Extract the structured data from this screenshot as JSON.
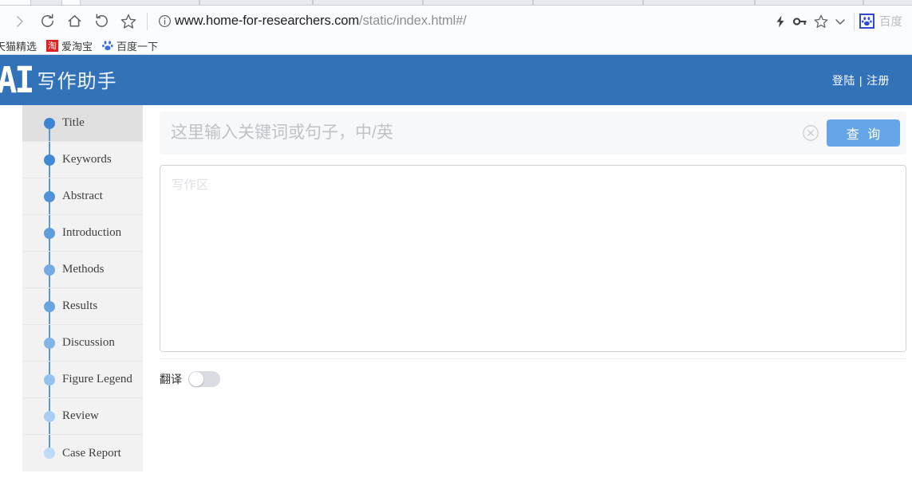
{
  "browser": {
    "toolbar_icons": [
      "forward-arrow-icon",
      "reload-icon",
      "home-icon",
      "back-history-icon",
      "bookmark-star-icon"
    ],
    "url_domain": "www.home-for-researchers.com",
    "url_path": "/static/index.html#/",
    "right_icons": [
      "lightning-icon",
      "key-icon",
      "star-icon",
      "chevron-down-icon"
    ],
    "extension_name": "百度",
    "extension_icon": "baidu-paw-icon",
    "bookmarks": [
      {
        "label": "天猫精选",
        "icon": ""
      },
      {
        "label": "爱淘宝",
        "icon": "taobao-icon"
      },
      {
        "label": "百度一下",
        "icon": "baidu-paw-icon"
      }
    ]
  },
  "header": {
    "logo_ai": "AI",
    "logo_cn": "写作助手",
    "login": "登陆",
    "divider": "|",
    "register": "注册"
  },
  "sidebar": {
    "items": [
      {
        "label": "Title",
        "active": true
      },
      {
        "label": "Keywords",
        "active": false
      },
      {
        "label": "Abstract",
        "active": false
      },
      {
        "label": "Introduction",
        "active": false
      },
      {
        "label": "Methods",
        "active": false
      },
      {
        "label": "Results",
        "active": false
      },
      {
        "label": "Discussion",
        "active": false
      },
      {
        "label": "Figure Legend",
        "active": false
      },
      {
        "label": "Review",
        "active": false
      },
      {
        "label": "Case Report",
        "active": false
      }
    ]
  },
  "search": {
    "value": "",
    "placeholder": "这里输入关键词或句子，中/英",
    "clear_icon": "clear-circle-icon",
    "button_label": "查 询"
  },
  "editor": {
    "value": "",
    "placeholder": "写作区"
  },
  "translate": {
    "label": "翻译",
    "enabled": false
  },
  "colors": {
    "header_blue": "#3272b8",
    "button_blue": "#65a5e8",
    "timeline_blue": "#3f84d2",
    "sidebar_bg": "#f2f2f2",
    "sidebar_active_bg": "#e0e0e0"
  }
}
